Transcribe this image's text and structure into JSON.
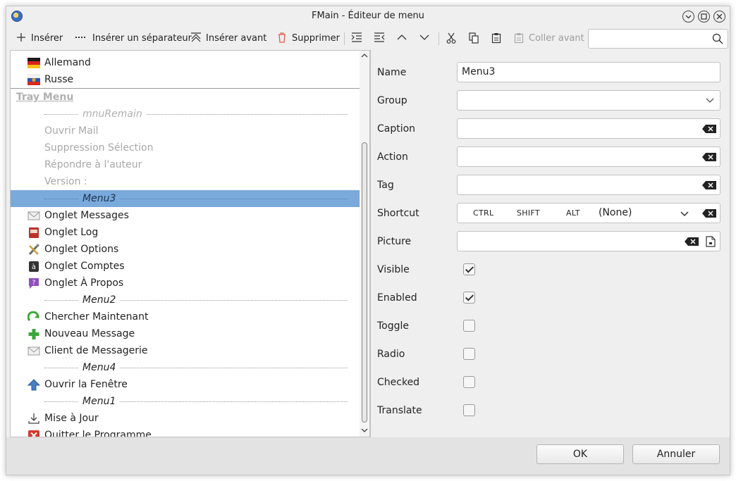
{
  "window": {
    "title": "FMain - Éditeur de menu",
    "controls": [
      "minimize-icon",
      "maximize-icon",
      "close-icon"
    ]
  },
  "toolbar": {
    "insert": "Insérer",
    "insert_separator": "Insérer un séparateur",
    "insert_before": "Insérer avant",
    "delete": "Supprimer",
    "paste_before": "Coller avant",
    "search_placeholder": ""
  },
  "tree": {
    "rows": [
      {
        "label": "Allemand",
        "icon": "flag-germany-icon",
        "kind": "item"
      },
      {
        "label": "Russe",
        "icon": "flag-russia-icon",
        "kind": "item"
      },
      {
        "label": "Tray Menu",
        "kind": "header"
      },
      {
        "label": "mnuRemain",
        "kind": "separator",
        "disabled": true
      },
      {
        "label": "Ouvrir Mail",
        "kind": "item",
        "disabled": true
      },
      {
        "label": "Suppression Sélection",
        "kind": "item",
        "disabled": true
      },
      {
        "label": "Répondre à l'auteur",
        "kind": "item",
        "disabled": true
      },
      {
        "label": "Version :",
        "kind": "item",
        "disabled": true
      },
      {
        "label": "Menu3",
        "kind": "separator",
        "selected": true
      },
      {
        "label": "Onglet Messages",
        "icon": "envelope-icon",
        "kind": "item"
      },
      {
        "label": "Onglet Log",
        "icon": "book-icon",
        "kind": "item"
      },
      {
        "label": "Onglet Options",
        "icon": "tools-icon",
        "kind": "item"
      },
      {
        "label": "Onglet Comptes",
        "icon": "account-icon",
        "kind": "item"
      },
      {
        "label": "Onglet À Propos",
        "icon": "help-bubble-icon",
        "kind": "item"
      },
      {
        "label": "Menu2",
        "kind": "separator"
      },
      {
        "label": "Chercher Maintenant",
        "icon": "refresh-icon",
        "kind": "item"
      },
      {
        "label": "Nouveau Message",
        "icon": "plus-icon",
        "kind": "item"
      },
      {
        "label": "Client de Messagerie",
        "icon": "envelope-icon",
        "kind": "item"
      },
      {
        "label": "Menu4",
        "kind": "separator"
      },
      {
        "label": "Ouvrir la Fenêtre",
        "icon": "arrow-up-icon",
        "kind": "item"
      },
      {
        "label": "Menu1",
        "kind": "separator"
      },
      {
        "label": "Mise à Jour",
        "icon": "download-icon",
        "kind": "item"
      },
      {
        "label": "Quitter le Programme",
        "icon": "quit-icon",
        "kind": "item"
      }
    ]
  },
  "properties": {
    "name_label": "Name",
    "name_value": "Menu3",
    "group_label": "Group",
    "group_value": "",
    "caption_label": "Caption",
    "caption_value": "",
    "action_label": "Action",
    "action_value": "",
    "tag_label": "Tag",
    "tag_value": "",
    "shortcut_label": "Shortcut",
    "shortcut_ctrl": "CTRL",
    "shortcut_shift": "SHIFT",
    "shortcut_alt": "ALT",
    "shortcut_key": "(None)",
    "picture_label": "Picture",
    "picture_value": "",
    "visible_label": "Visible",
    "visible": true,
    "enabled_label": "Enabled",
    "enabled": true,
    "toggle_label": "Toggle",
    "toggle": false,
    "radio_label": "Radio",
    "radio": false,
    "checked_label": "Checked",
    "checked": false,
    "translate_label": "Translate",
    "translate": false
  },
  "buttons": {
    "ok": "OK",
    "cancel": "Annuler"
  }
}
